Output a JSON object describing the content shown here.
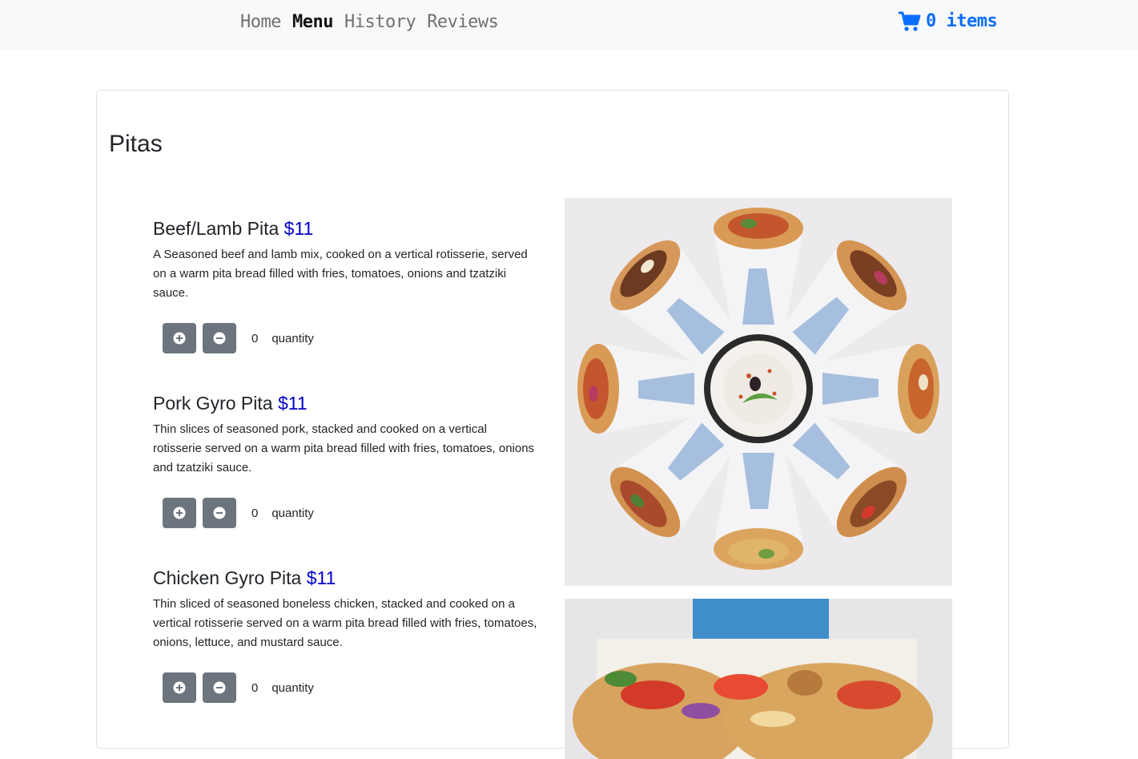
{
  "nav": {
    "links": [
      {
        "label": "Home",
        "active": false
      },
      {
        "label": "Menu",
        "active": true
      },
      {
        "label": "History",
        "active": false
      },
      {
        "label": "Reviews",
        "active": false
      }
    ],
    "cart": {
      "count_label": "0 items",
      "icon": "shopping-cart-icon"
    }
  },
  "section": {
    "title": "Pitas"
  },
  "items": [
    {
      "name": "Beef/Lamb Pita",
      "price": "$11",
      "description": "A Seasoned beef and lamb mix, cooked on a vertical rotisserie, served on a warm pita bread filled with fries, tomatoes, onions and tzatziki sauce.",
      "quantity": "0",
      "quantity_label": "quantity"
    },
    {
      "name": "Pork Gyro Pita",
      "price": "$11",
      "description": "Thin slices of seasoned pork, stacked and cooked on a vertical rotisserie served on a warm pita bread filled with fries, tomatoes, onions and tzatziki sauce.",
      "quantity": "0",
      "quantity_label": "quantity"
    },
    {
      "name": "Chicken Gyro Pita",
      "price": "$11",
      "description": "Thin sliced of seasoned boneless chicken, stacked and cooked on a vertical rotisserie served on a warm pita bread filled with fries, tomatoes, onions, lettuce, and mustard sauce.",
      "quantity": "0",
      "quantity_label": "quantity"
    }
  ],
  "colors": {
    "navbar_bg": "#f8f9fa",
    "cart": "#0d6efd",
    "price": "#0000cc",
    "button": "#6c757d"
  }
}
